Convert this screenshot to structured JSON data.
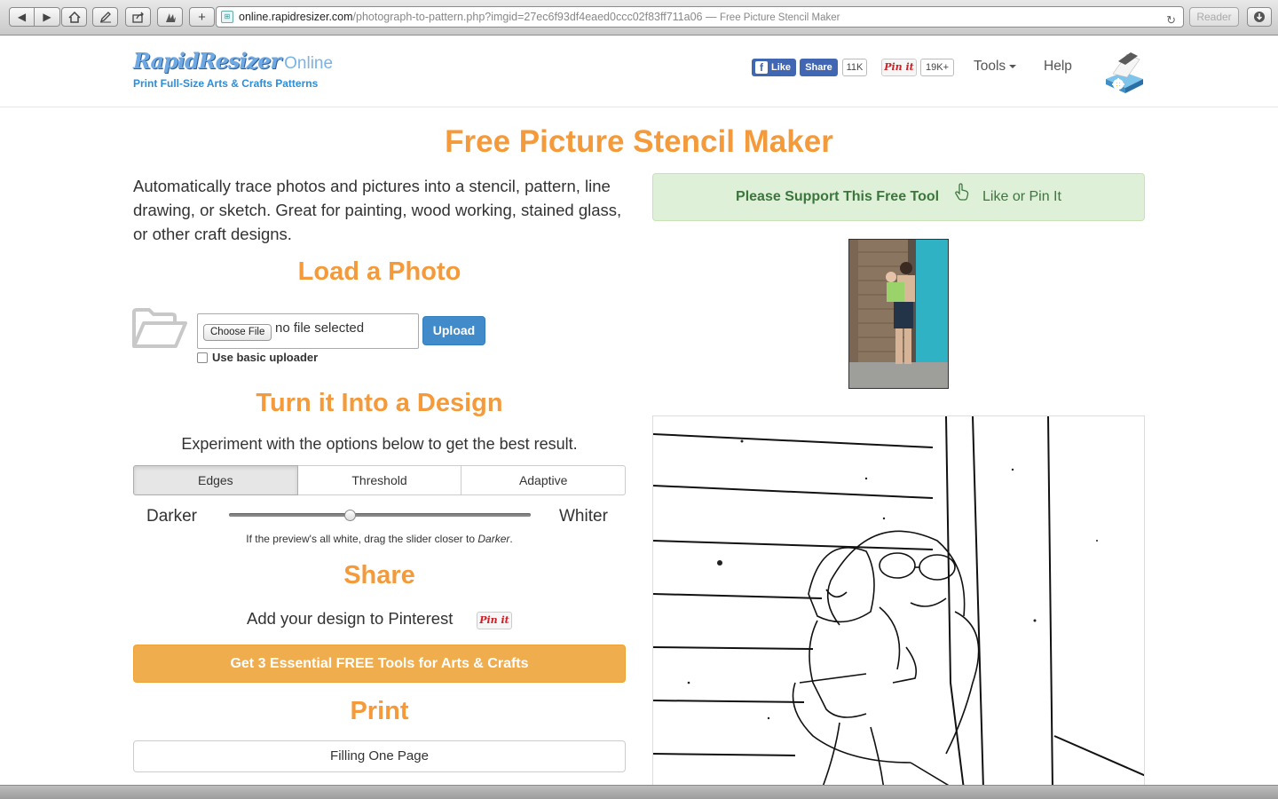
{
  "browser": {
    "url_host": "online.rapidresizer.com",
    "url_path": "/photograph-to-pattern.php?imgid=27ec6f93df4eaed0ccc02f83ff711a06",
    "url_separator": " — ",
    "page_title": "Free Picture Stencil Maker",
    "reader_label": "Reader"
  },
  "header": {
    "logo_text": "RapidResizer",
    "logo_suffix": "Online",
    "tagline": "Print Full-Size Arts & Crafts Patterns",
    "fb_like_label": "Like",
    "fb_share_label": "Share",
    "fb_count": "11K",
    "pin_label": "Pin it",
    "pin_count": "19K+",
    "nav_tools": "Tools",
    "nav_help": "Help"
  },
  "main": {
    "title": "Free Picture Stencil Maker",
    "intro": "Automatically trace photos and pictures into a stencil, pattern, line drawing, or sketch. Great for painting, wood working, stained glass, or other craft designs.",
    "load": {
      "heading": "Load a Photo",
      "choose_file_label": "Choose File",
      "file_status": "no file selected",
      "upload_label": "Upload",
      "basic_uploader_label": "Use basic uploader",
      "basic_uploader_checked": false
    },
    "design": {
      "heading": "Turn it Into a Design",
      "instructions": "Experiment with the options below to get the best result.",
      "tabs": [
        {
          "label": "Edges",
          "active": true
        },
        {
          "label": "Threshold",
          "active": false
        },
        {
          "label": "Adaptive",
          "active": false
        }
      ],
      "slider_min_label": "Darker",
      "slider_max_label": "Whiter",
      "slider_value_fraction": 0.4,
      "hint_prefix": "If the preview's all white, drag the slider closer to ",
      "hint_emphasis": "Darker",
      "hint_suffix": "."
    },
    "share": {
      "heading": "Share",
      "pinterest_text": "Add your design to Pinterest",
      "pin_label": "Pin it",
      "cta_label": "Get 3 Essential FREE Tools for Arts & Crafts"
    },
    "print": {
      "heading": "Print",
      "option_label": "Filling One Page"
    }
  },
  "sidebar": {
    "support_strong": "Please Support This Free Tool",
    "support_action": "Like or Pin It"
  },
  "colors": {
    "accent_orange": "#f49a3a",
    "cta_orange": "#f0ad4e",
    "upload_blue": "#428bca",
    "facebook_blue": "#4267b2",
    "support_green_bg": "#dff0d8",
    "support_green_text": "#3c763d",
    "logo_blue": "#6ea9e3"
  }
}
